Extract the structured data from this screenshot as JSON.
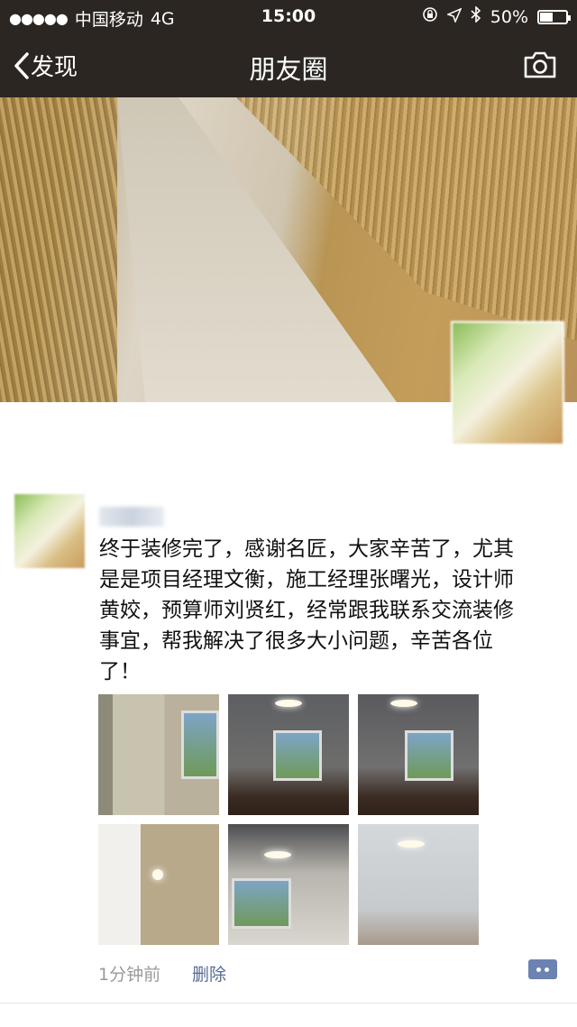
{
  "status_bar": {
    "signal_dots": "●●●●●",
    "carrier": "中国移动",
    "network": "4G",
    "time": "15:00",
    "battery": "50%",
    "battery_level": 0.5
  },
  "nav": {
    "back_label": "发现",
    "title": "朋友圈"
  },
  "post": {
    "text": "终于装修完了，感谢名匠，大家辛苦了，尤其是是项目经理文衡，施工经理张曙光，设计师黄姣，预算师刘贤红，经常跟我联系交流装修事宜，帮我解决了很多大小问题，辛苦各位了！",
    "time_ago": "1分钟前",
    "delete_label": "删除"
  },
  "colors": {
    "navbar": "#2b2621",
    "link": "#576b95",
    "meta": "#9a9a9a"
  }
}
